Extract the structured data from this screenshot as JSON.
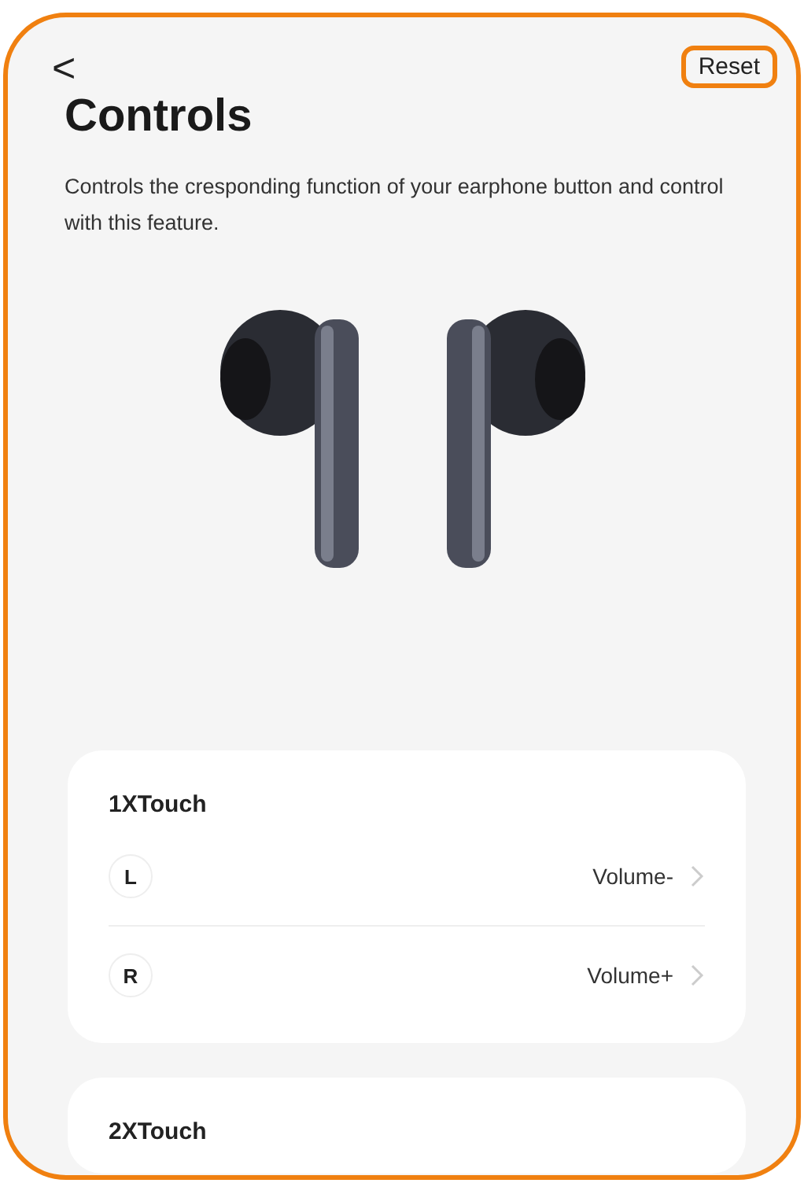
{
  "header": {
    "back_icon": "<",
    "reset": {
      "label": "Reset",
      "highlighted": true
    }
  },
  "title": "Controls",
  "description": "Controls the cresponding function of your earphone button and control with this feature.",
  "sections": [
    {
      "title": "1XTouch",
      "rows": [
        {
          "side": "L",
          "action": "Volume-"
        },
        {
          "side": "R",
          "action": "Volume+"
        }
      ]
    },
    {
      "title": "2XTouch"
    }
  ]
}
